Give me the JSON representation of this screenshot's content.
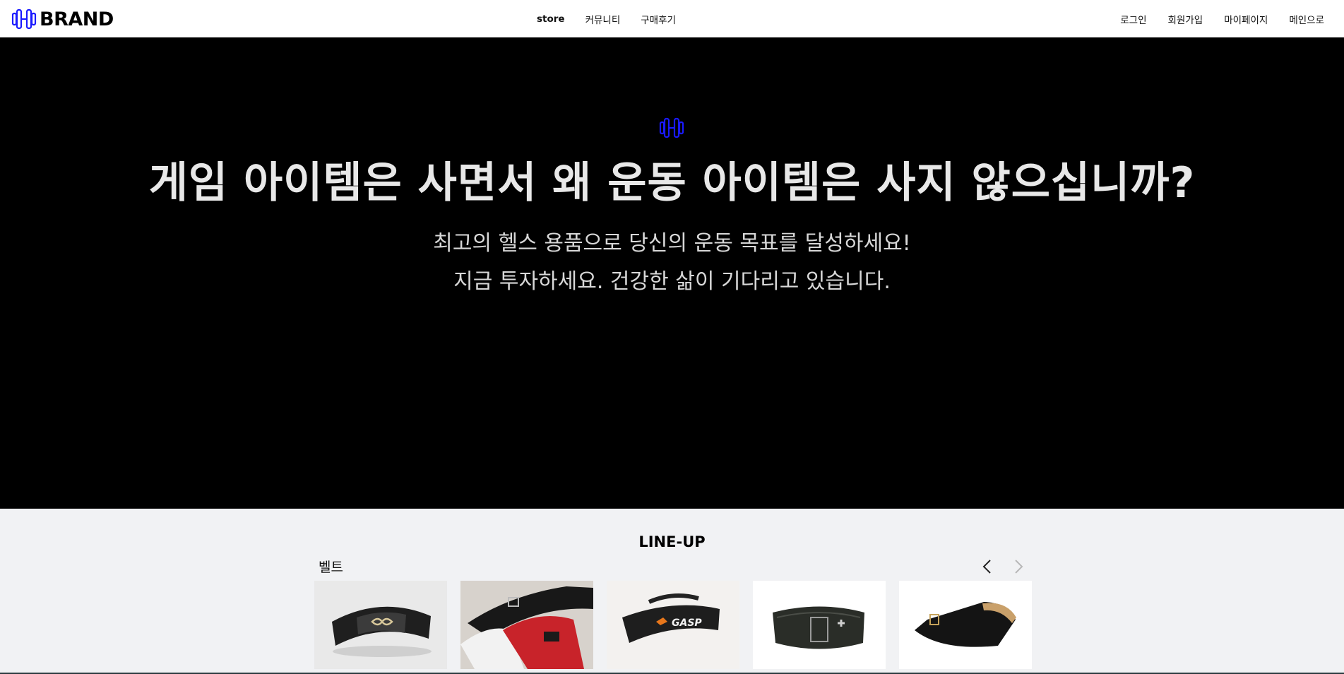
{
  "header": {
    "brand": "BRAND",
    "nav_center": [
      {
        "label": "store",
        "active": true
      },
      {
        "label": "커뮤니티",
        "active": false
      },
      {
        "label": "구매후기",
        "active": false
      }
    ],
    "nav_right": [
      {
        "label": "로그인"
      },
      {
        "label": "회원가입"
      },
      {
        "label": "마이페이지"
      },
      {
        "label": "메인으로"
      }
    ]
  },
  "hero": {
    "icon": "dumbbell-icon",
    "title": "게임 아이템은 사면서 왜 운동 아이템은 사지 않으십니까?",
    "subtitle_line1": "최고의 헬스 용품으로 당신의 운동 목표를 달성하세요!",
    "subtitle_line2": "지금 투자하세요. 건강한 삶이 기다리고 있습니다."
  },
  "lineup": {
    "title": "LINE-UP",
    "category": "벨트",
    "prev_icon": "chevron-left-icon",
    "next_icon": "chevron-right-icon",
    "products": [
      {
        "image": "belt-product-image"
      },
      {
        "image": "belt-product-image"
      },
      {
        "image": "belt-product-image"
      },
      {
        "image": "belt-product-image"
      },
      {
        "image": "belt-product-image"
      }
    ]
  },
  "colors": {
    "brand_icon": "#1a1aff",
    "hero_bg": "#000000",
    "lineup_bg": "#f1f2f4"
  }
}
